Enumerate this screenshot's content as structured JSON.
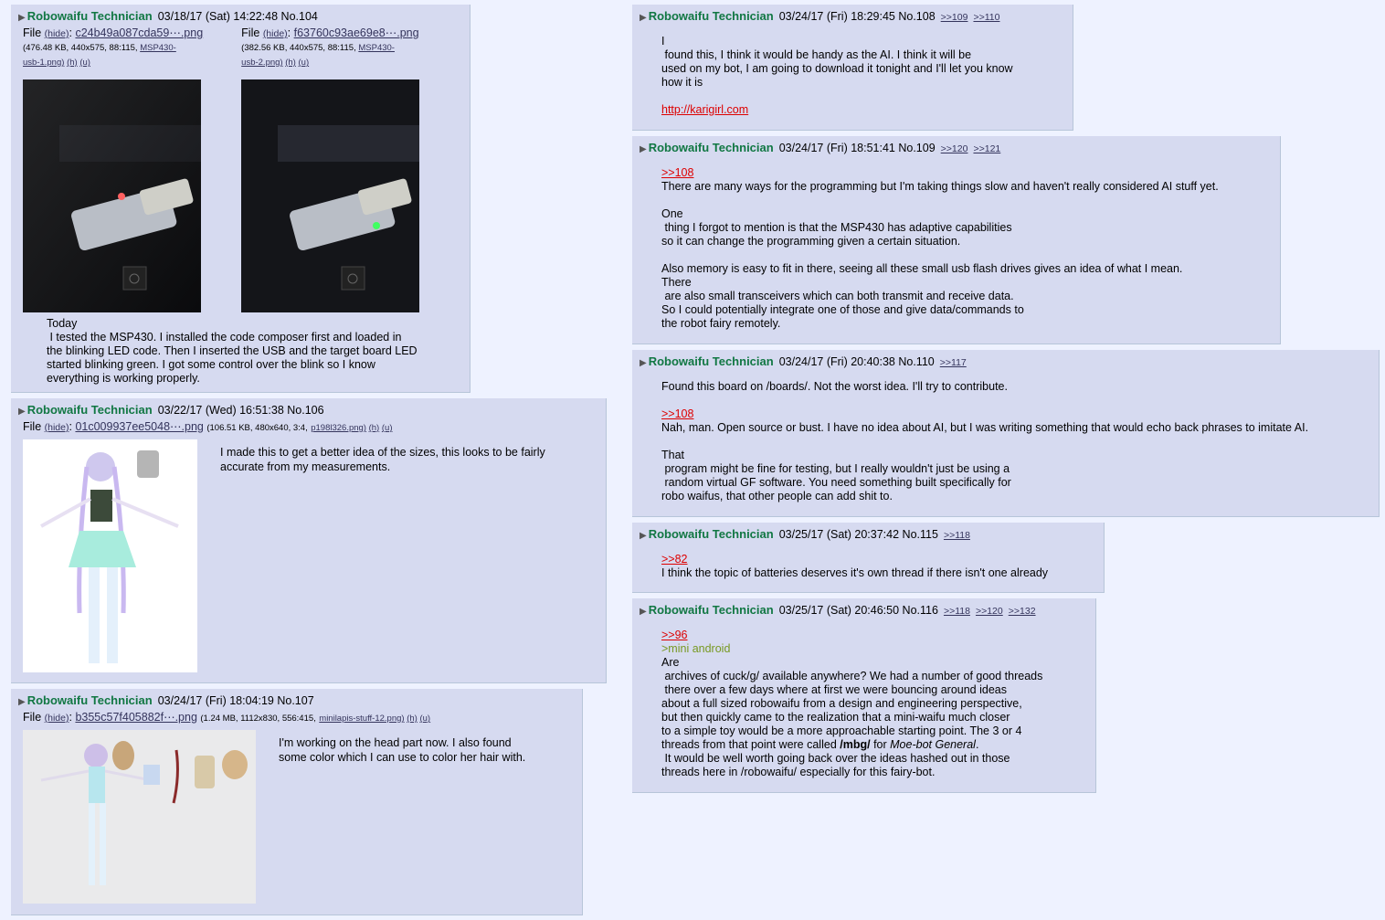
{
  "posts": [
    {
      "name": "Robowaifu Technician",
      "date": "03/18/17 (Sat) 14:22:48",
      "no": "No.104",
      "files": [
        {
          "label": "File",
          "hide": "(hide)",
          "filename": "c24b49a087cda59⋯.png",
          "info": "(476.48 KB, 440x575, 88:115,",
          "orig1": "MSP430-",
          "orig2": "usb-1.png)",
          "h": "(h)",
          "u": "(u)"
        },
        {
          "label": "File",
          "hide": "(hide)",
          "filename": "f63760c93ae69e8⋯.png",
          "info": "(382.56 KB, 440x575, 88:115,",
          "orig1": "MSP430-",
          "orig2": "usb-2.png)",
          "h": "(h)",
          "u": "(u)"
        }
      ],
      "body": [
        "Today",
        " I tested the MSP430. I installed the code composer first and loaded in",
        "the blinking LED code. Then I inserted the USB and the target board LED",
        "started blinking green. I got some control over the blink so I know",
        "everything is working properly."
      ]
    },
    {
      "name": "Robowaifu Technician",
      "date": "03/22/17 (Wed) 16:51:38",
      "no": "No.106",
      "file": {
        "label": "File",
        "hide": "(hide)",
        "filename": "01c009937ee5048⋯.png",
        "info": "(106.51 KB, 480x640, 3:4,",
        "orig": "p198l326.png)",
        "h": "(h)",
        "u": "(u)"
      },
      "body": [
        "I made this to get a better idea of the sizes, this looks to be fairly",
        "accurate from my measurements."
      ]
    },
    {
      "name": "Robowaifu Technician",
      "date": "03/24/17 (Fri) 18:04:19",
      "no": "No.107",
      "file": {
        "label": "File",
        "hide": "(hide)",
        "filename": "b355c57f405882f⋯.png",
        "info": "(1.24 MB, 1112x830, 556:415,",
        "orig": "minilapis-stuff-12.png)",
        "h": "(h)",
        "u": "(u)"
      },
      "body": [
        "I'm working on the head part now. I also found",
        "some color which I can use to color her hair with."
      ]
    },
    {
      "name": "Robowaifu Technician",
      "date": "03/24/17 (Fri) 18:29:45",
      "no": "No.108",
      "backlinks": [
        ">>109",
        ">>110"
      ],
      "body": [
        "I",
        " found this, I think it would be handy as the AI. I think it will be",
        "used on my bot, I am going to download it tonight and I'll let you know",
        "how it is"
      ],
      "link": "http://karigirl.com"
    },
    {
      "name": "Robowaifu Technician",
      "date": "03/24/17 (Fri) 18:51:41",
      "no": "No.109",
      "backlinks": [
        ">>120",
        ">>121"
      ],
      "quote": ">>108",
      "body1": [
        "There are many ways for the programming but I'm taking things slow and haven't really considered AI stuff yet."
      ],
      "body2": [
        "One",
        " thing I forgot to mention is that the MSP430 has adaptive capabilities",
        "so it can change the programming given a certain situation."
      ],
      "body3": [
        "Also memory is easy to fit in there, seeing all these small usb flash drives gives an idea of what I mean.",
        "There",
        " are also small transceivers which can both transmit and receive data.",
        "So I could potentially integrate one of those and give data/commands to",
        "the robot fairy remotely."
      ]
    },
    {
      "name": "Robowaifu Technician",
      "date": "03/24/17 (Fri) 20:40:38",
      "no": "No.110",
      "backlinks": [
        ">>117"
      ],
      "body1": [
        "Found this board on /boards/. Not the worst idea. I'll try to contribute."
      ],
      "quote": ">>108",
      "body2": [
        "Nah, man. Open source or bust. I have no idea about AI, but I was writing something that would echo back phrases to imitate AI."
      ],
      "body3": [
        "That",
        " program might be fine for testing, but I really wouldn't just be using a",
        " random virtual GF software. You need something built specifically for",
        "robo waifus, that other people can add shit to."
      ]
    },
    {
      "name": "Robowaifu Technician",
      "date": "03/25/17 (Sat) 20:37:42",
      "no": "No.115",
      "backlinks": [
        ">>118"
      ],
      "quote": ">>82",
      "body": [
        "I think the topic of batteries deserves it's own thread if there isn't one already"
      ]
    },
    {
      "name": "Robowaifu Technician",
      "date": "03/25/17 (Sat) 20:46:50",
      "no": "No.116",
      "backlinks": [
        ">>118",
        ">>120",
        ">>132"
      ],
      "quote": ">>96",
      "greentext": ">mini android",
      "body": [
        "Are",
        " archives of cuck/g/ available anywhere? We had a number of good threads",
        " there over a few days where at first we were bouncing around ideas",
        "about a full sized robowaifu from a design and engineering perspective,",
        "but then quickly came to the realization that a mini-waifu much closer",
        "to a simple toy would be a more approachable starting point. The 3 or 4"
      ],
      "line_pre": "threads from that point were called ",
      "line_bold": "/mbg/",
      "line_mid": " for ",
      "line_ital": "Moe-bot General",
      "line_end": ".",
      "body_tail": [
        " It would be well worth going back over the ideas hashed out in those",
        "threads here in /robowaifu/ especially for this fairy-bot."
      ]
    }
  ],
  "colors": {
    "post_bg": "#d6daf0",
    "page_bg": "#eef2ff",
    "name": "#117743",
    "quote": "#dd0000",
    "greentext": "#789922",
    "link": "#34345c"
  }
}
